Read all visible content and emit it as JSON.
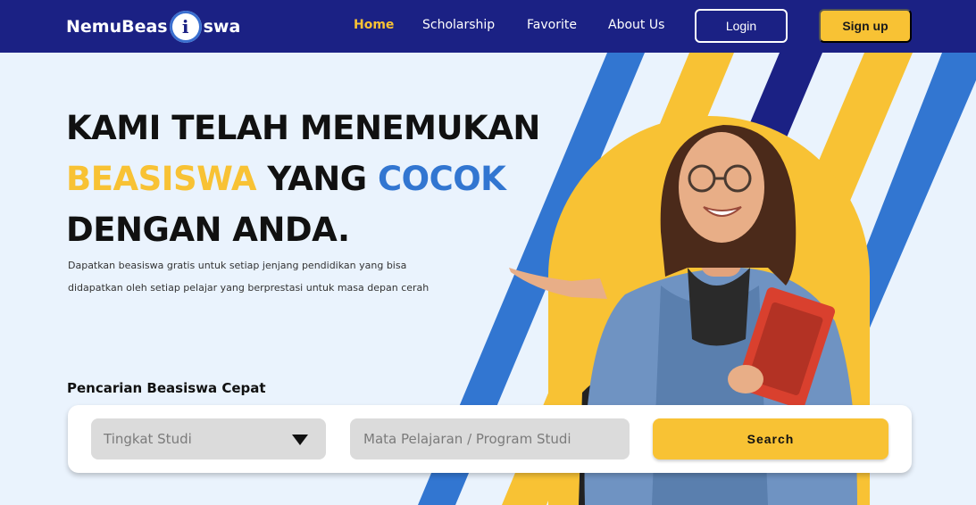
{
  "brand": {
    "prefix": "NemuBeas",
    "icon_letter": "i",
    "suffix": "swa"
  },
  "nav": {
    "home": "Home",
    "scholarship": "Scholarship",
    "favorite": "Favorite",
    "about": "About Us",
    "login": "Login",
    "signup": "Sign up"
  },
  "hero": {
    "line1": "KAMI TELAH MENEMUKAN",
    "line2_yellow": "BEASISWA",
    "line2_mid": " YANG ",
    "line2_blue": "COCOK",
    "line3": "DENGAN ANDA.",
    "sub1": "Dapatkan beasiswa gratis untuk setiap jenjang pendidikan yang bisa",
    "sub2": "didapatkan oleh setiap pelajar yang berprestasi untuk masa depan cerah"
  },
  "search": {
    "label": "Pencarian Beasiswa Cepat",
    "level_selected": "Tingkat Studi",
    "subject_placeholder": "Mata Pelajaran / Program Studi",
    "button": "Search"
  },
  "colors": {
    "navy": "#1b2184",
    "yellow": "#f8c234",
    "blue": "#3276d1",
    "background": "#eaf3fd"
  }
}
